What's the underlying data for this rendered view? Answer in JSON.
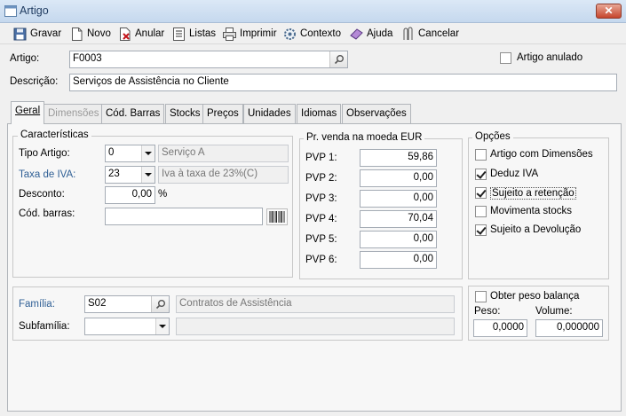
{
  "window": {
    "title": "Artigo",
    "close_label": "✕"
  },
  "toolbar": {
    "buttons": [
      {
        "label": "Gravar",
        "icon": "save-icon"
      },
      {
        "label": "Novo",
        "icon": "new-document-icon"
      },
      {
        "label": "Anular",
        "icon": "cancel-document-icon"
      },
      {
        "label": "Listas",
        "icon": "list-icon"
      },
      {
        "label": "Imprimir",
        "icon": "printer-icon"
      },
      {
        "label": "Contexto",
        "icon": "gear-icon"
      },
      {
        "label": "Ajuda",
        "icon": "help-book-icon"
      },
      {
        "label": "Cancelar",
        "icon": "cancel-icon"
      }
    ]
  },
  "header": {
    "artigo_label": "Artigo:",
    "artigo_value": "F0003",
    "descricao_label": "Descrição:",
    "descricao_value": "Serviços de Assistência no Cliente",
    "anulado_label": "Artigo anulado",
    "anulado_checked": false
  },
  "tabs": [
    {
      "label": "Geral",
      "active": true
    },
    {
      "label": "Dimensões",
      "disabled": true
    },
    {
      "label": "Cód. Barras"
    },
    {
      "label": "Stocks"
    },
    {
      "label": "Preços"
    },
    {
      "label": "Unidades"
    },
    {
      "label": "Idiomas"
    },
    {
      "label": "Observações"
    }
  ],
  "caracteristicas": {
    "title": "Características",
    "tipo_label": "Tipo Artigo:",
    "tipo_value": "0",
    "tipo_desc": "Serviço A",
    "iva_label": "Taxa de IVA:",
    "iva_value": "23",
    "iva_desc": "Iva à taxa de 23%(C)",
    "desconto_label": "Desconto:",
    "desconto_value": "0,00",
    "desconto_unit": "%",
    "barras_label": "Cód. barras:",
    "barras_value": ""
  },
  "precos": {
    "title": "Pr. venda na moeda EUR",
    "rows": [
      {
        "label": "PVP 1:",
        "value": "59,86"
      },
      {
        "label": "PVP 2:",
        "value": "0,00"
      },
      {
        "label": "PVP 3:",
        "value": "0,00"
      },
      {
        "label": "PVP 4:",
        "value": "70,04"
      },
      {
        "label": "PVP 5:",
        "value": "0,00"
      },
      {
        "label": "PVP 6:",
        "value": "0,00"
      }
    ]
  },
  "opcoes": {
    "title": "Opções",
    "items": [
      {
        "label": "Artigo com Dimensões",
        "checked": false
      },
      {
        "label": "Deduz IVA",
        "checked": true
      },
      {
        "label": "Sujeito a retenção",
        "checked": true
      },
      {
        "label": "Movimenta stocks",
        "checked": false
      },
      {
        "label": "Sujeito a Devolução",
        "checked": true
      }
    ]
  },
  "familia": {
    "familia_label": "Família:",
    "familia_value": "S02",
    "familia_desc": "Contratos de Assistência",
    "subfamilia_label": "Subfamília:",
    "subfamilia_value": "",
    "subfamilia_desc": ""
  },
  "peso": {
    "balanca_label": "Obter peso balança",
    "balanca_checked": false,
    "peso_label": "Peso:",
    "peso_value": "0,0000",
    "volume_label": "Volume:",
    "volume_value": "0,000000"
  }
}
